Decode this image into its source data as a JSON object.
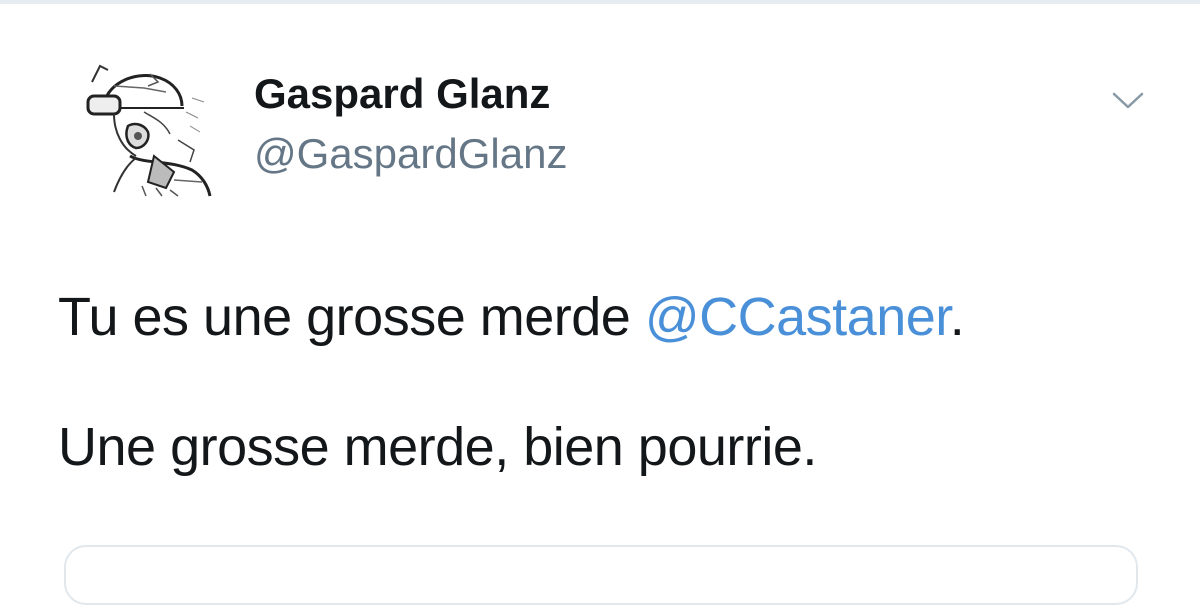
{
  "tweet": {
    "author": {
      "display_name": "Gaspard Glanz",
      "handle": "@GaspardGlanz",
      "avatar_icon": "sketch-helmeted-figure-avatar"
    },
    "menu_icon": "chevron-down-icon",
    "text": {
      "line1_before": "Tu es une grosse merde ",
      "line1_mention": "@CCastaner",
      "line1_after": ".",
      "line2": "Une grosse merde, bien pourrie."
    }
  },
  "colors": {
    "text": "#14171a",
    "secondary": "#657786",
    "link": "#4a90d9",
    "divider": "#e6ecf0"
  }
}
